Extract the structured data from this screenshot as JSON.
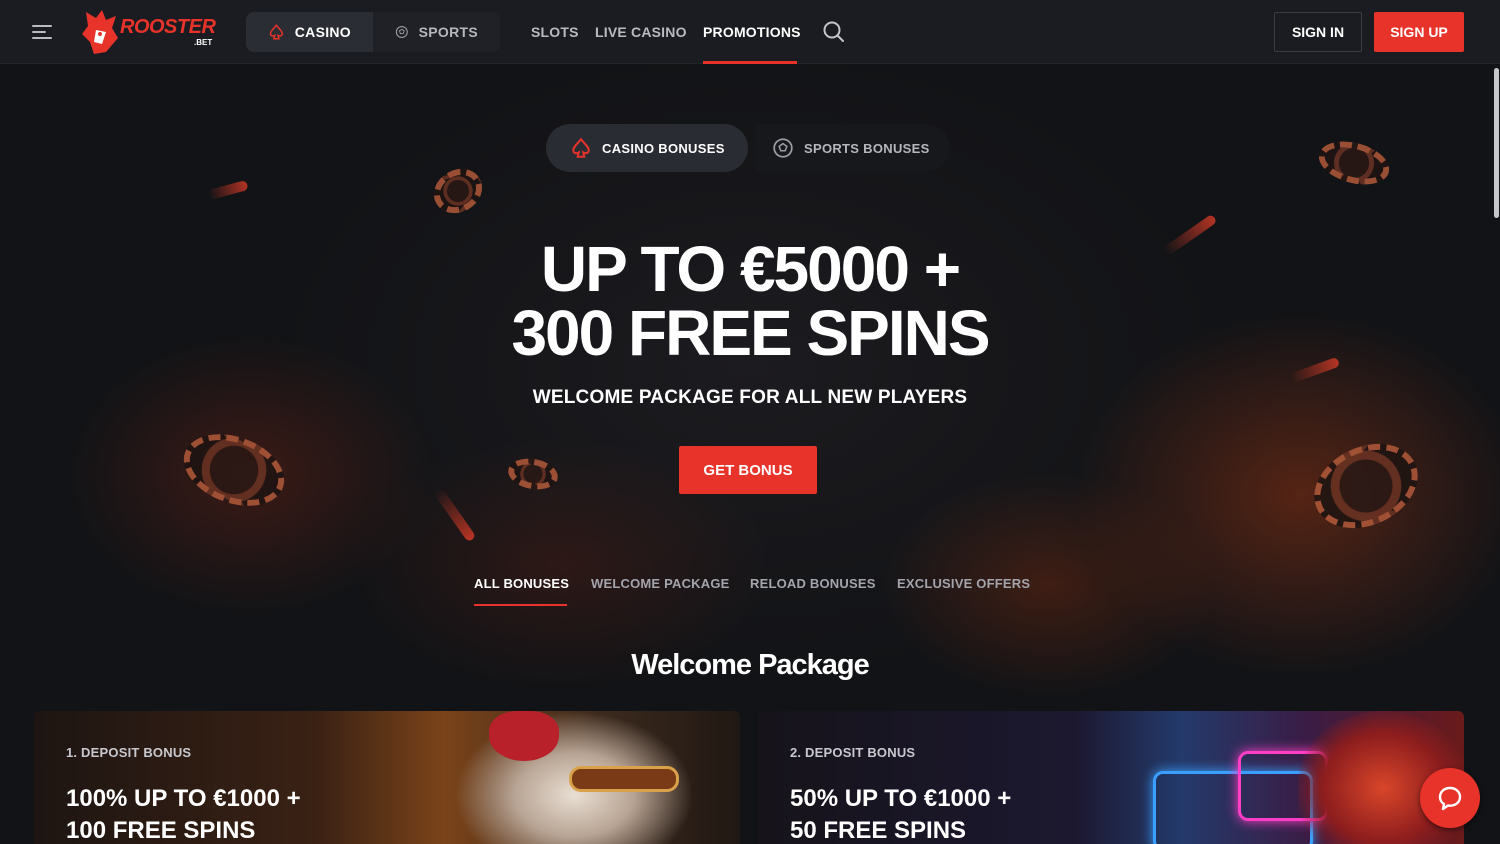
{
  "header": {
    "logo_text": "ROOSTER",
    "logo_sub": ".BET",
    "casino_tab": "CASINO",
    "sports_tab": "SPORTS",
    "nav": [
      {
        "label": "SLOTS"
      },
      {
        "label": "LIVE CASINO"
      },
      {
        "label": "PROMOTIONS",
        "active": true
      }
    ],
    "signin_label": "SIGN IN",
    "signup_label": "SIGN UP"
  },
  "hero": {
    "casino_bonuses_label": "CASINO BONUSES",
    "sports_bonuses_label": "SPORTS BONUSES",
    "headline_line1": "UP TO €5000 +",
    "headline_line2": "300 FREE SPINS",
    "subline": "WELCOME PACKAGE FOR ALL NEW PLAYERS",
    "cta_label": "GET BONUS"
  },
  "filters": [
    {
      "label": "ALL BONUSES",
      "active": true
    },
    {
      "label": "WELCOME PACKAGE"
    },
    {
      "label": "RELOAD BONUSES"
    },
    {
      "label": "EXCLUSIVE OFFERS"
    }
  ],
  "section": {
    "title": "Welcome Package"
  },
  "cards": [
    {
      "label": "1. DEPOSIT BONUS",
      "title_line1": "100% UP TO €1000 +",
      "title_line2": "100 FREE SPINS"
    },
    {
      "label": "2. DEPOSIT BONUS",
      "title_line1": "50% UP TO €1000 +",
      "title_line2": "50 FREE SPINS"
    }
  ],
  "colors": {
    "accent": "#e8332a",
    "header_bg": "#1b1c21",
    "page_bg": "#121316"
  },
  "icons": {
    "menu": "hamburger-icon",
    "casino": "spade-icon",
    "sports": "soccer-ball-icon",
    "search": "search-icon",
    "chat": "chat-bubble-icon"
  }
}
